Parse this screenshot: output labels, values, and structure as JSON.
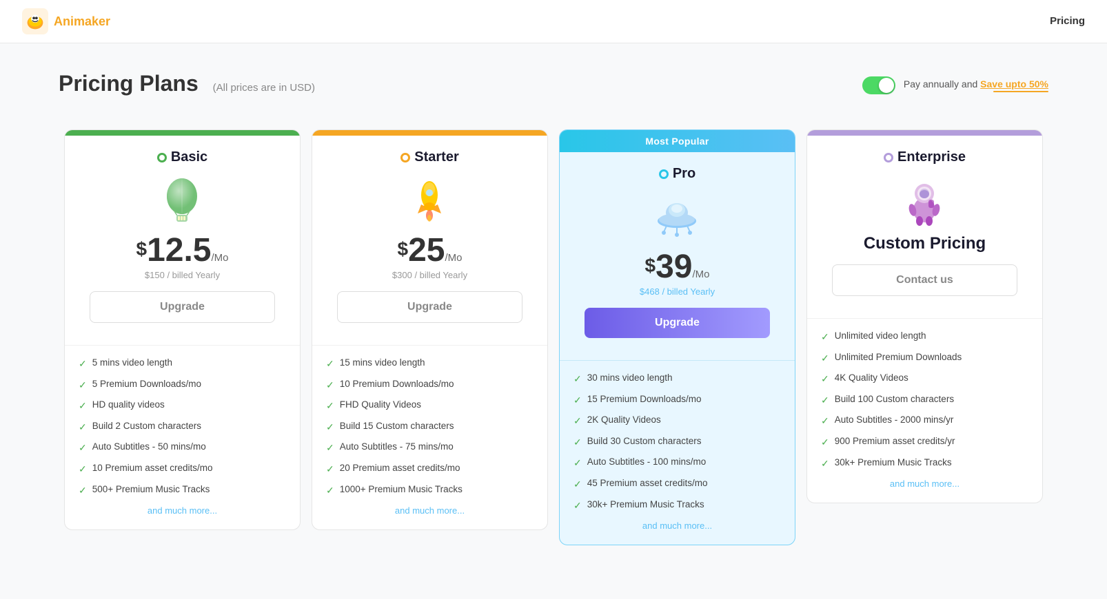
{
  "header": {
    "logo_text": "Animaker",
    "nav_label": "Pricing"
  },
  "page": {
    "title": "Pricing Plans",
    "subtitle": "(All prices are in USD)",
    "billing_text": "Pay annually and ",
    "save_text": "Save upto 50%"
  },
  "plans": [
    {
      "id": "basic",
      "name": "Basic",
      "dot_class": "dot-green",
      "bar_class": "bar-green",
      "price_symbol": "$",
      "price_amount": "12.5",
      "price_period": "/Mo",
      "billed": "$150 / billed Yearly",
      "btn_label": "Upgrade",
      "btn_class": "plan-btn",
      "most_popular": false,
      "features": [
        "5 mins video length",
        "5 Premium Downloads/mo",
        "HD quality videos",
        "Build 2 Custom characters",
        "Auto Subtitles - 50 mins/mo",
        "10 Premium asset credits/mo",
        "500+ Premium Music Tracks"
      ],
      "more_link": "and much more..."
    },
    {
      "id": "starter",
      "name": "Starter",
      "dot_class": "dot-yellow",
      "bar_class": "bar-yellow",
      "price_symbol": "$",
      "price_amount": "25",
      "price_period": "/Mo",
      "billed": "$300 / billed Yearly",
      "btn_label": "Upgrade",
      "btn_class": "plan-btn",
      "most_popular": false,
      "features": [
        "15 mins video length",
        "10 Premium Downloads/mo",
        "FHD Quality Videos",
        "Build 15 Custom characters",
        "Auto Subtitles - 75 mins/mo",
        "20 Premium asset credits/mo",
        "1000+ Premium Music Tracks"
      ],
      "more_link": "and much more..."
    },
    {
      "id": "pro",
      "name": "Pro",
      "dot_class": "dot-cyan",
      "bar_class": "bar-cyan",
      "price_symbol": "$",
      "price_amount": "39",
      "price_period": "/Mo",
      "billed": "$468 / billed Yearly",
      "btn_label": "Upgrade",
      "btn_class": "plan-btn upgrade-btn",
      "most_popular": true,
      "most_popular_label": "Most Popular",
      "features": [
        "30 mins video length",
        "15 Premium Downloads/mo",
        "2K Quality Videos",
        "Build 30 Custom characters",
        "Auto Subtitles - 100 mins/mo",
        "45 Premium asset credits/mo",
        "30k+ Premium Music Tracks"
      ],
      "more_link": "and much more..."
    },
    {
      "id": "enterprise",
      "name": "Enterprise",
      "dot_class": "dot-purple",
      "bar_class": "bar-purple",
      "price_symbol": "",
      "price_amount": "",
      "price_period": "",
      "billed": "",
      "custom_pricing": "Custom Pricing",
      "btn_label": "Contact us",
      "btn_class": "plan-btn",
      "most_popular": false,
      "features": [
        "Unlimited video length",
        "Unlimited Premium Downloads",
        "4K Quality Videos",
        "Build 100 Custom characters",
        "Auto Subtitles - 2000 mins/yr",
        "900 Premium asset credits/yr",
        "30k+ Premium Music Tracks"
      ],
      "more_link": "and much more..."
    }
  ],
  "colors": {
    "green": "#4caf50",
    "yellow": "#f5a623",
    "cyan": "#29c6e8",
    "purple": "#b39ddb",
    "upgrade_gradient_start": "#6c5ce7",
    "upgrade_gradient_end": "#a29bfe"
  }
}
